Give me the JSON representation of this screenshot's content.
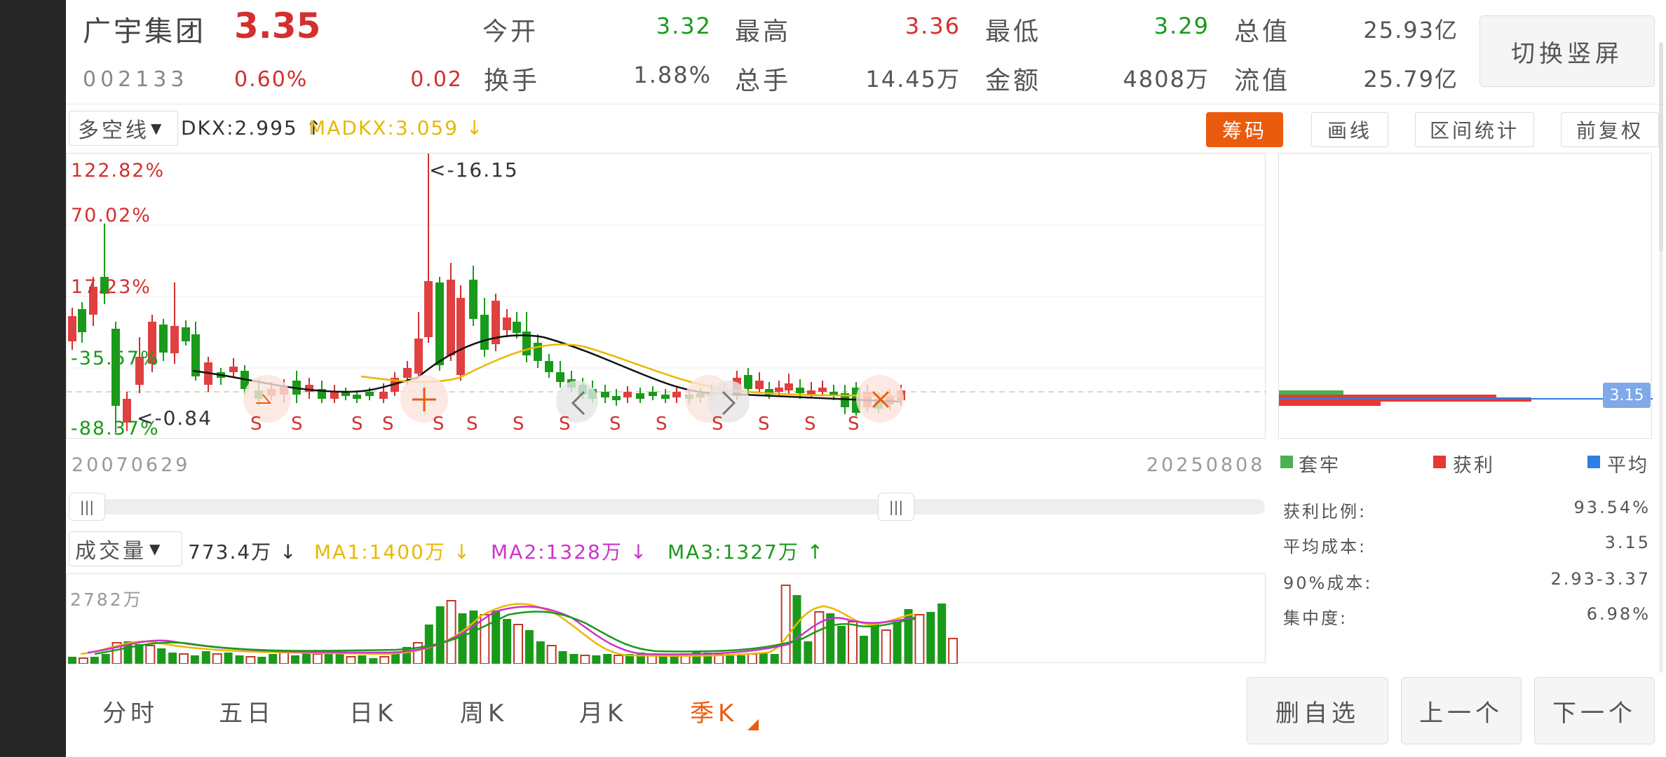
{
  "colors": {
    "up": "#d32f2f",
    "down": "#1a9a1a",
    "accent": "#ea5b0e",
    "ma_yellow": "#e8b800",
    "ma_magenta": "#cc33cc",
    "ma_green": "#1a9a1a",
    "avg_blue": "#2f7de1"
  },
  "header": {
    "name": "广宇集团",
    "price": "3.35",
    "code": "002133",
    "change_pct": "0.60%",
    "change": "0.02",
    "open_label": "今开",
    "open": "3.32",
    "high_label": "最高",
    "high": "3.36",
    "low_label": "最低",
    "low": "3.29",
    "mcap_label": "总值",
    "mcap": "25.93亿",
    "turnover_label": "换手",
    "turnover": "1.88%",
    "vol_label": "总手",
    "vol": "14.45万",
    "amount_label": "金额",
    "amount": "4808万",
    "float_label": "流值",
    "float_mcap": "25.79亿",
    "switch_label": "切换竖屏"
  },
  "indicator_bar": {
    "selector": "多空线",
    "dkx": "DKX:2.995 ↑",
    "madkx": "MADKX:3.059 ↓",
    "buttons": [
      "筹码",
      "画线",
      "区间统计",
      "前复权"
    ]
  },
  "main_chart": {
    "y_labels": [
      "122.82%",
      "70.02%",
      "17.23%",
      "-35.57%",
      "-88.37%"
    ],
    "high_mark": "<-16.15",
    "low_mark": "<-0.84",
    "start_date": "20070629",
    "end_date": "20250808",
    "signal_letter": "S"
  },
  "chip_panel": {
    "legend": [
      "套牢",
      "获利",
      "平均"
    ],
    "avg_tag": "3.15",
    "stats": [
      {
        "label": "获利比例:",
        "value": "93.54%"
      },
      {
        "label": "平均成本:",
        "value": "3.15"
      },
      {
        "label": "90%成本:",
        "value": "2.93-3.37"
      },
      {
        "label": "集中度:",
        "value": "6.98%"
      }
    ]
  },
  "volume_bar": {
    "selector": "成交量",
    "vol": "773.4万 ↓",
    "ma1": "MA1:1400万 ↓",
    "ma2": "MA2:1328万 ↓",
    "ma3": "MA3:1327万 ↑",
    "max_label": "2782万"
  },
  "period_tabs": [
    "分时",
    "五日",
    "日K",
    "周K",
    "月K",
    "季K"
  ],
  "active_tab": "季K",
  "bottom_buttons": [
    "删自选",
    "上一个",
    "下一个"
  ]
}
